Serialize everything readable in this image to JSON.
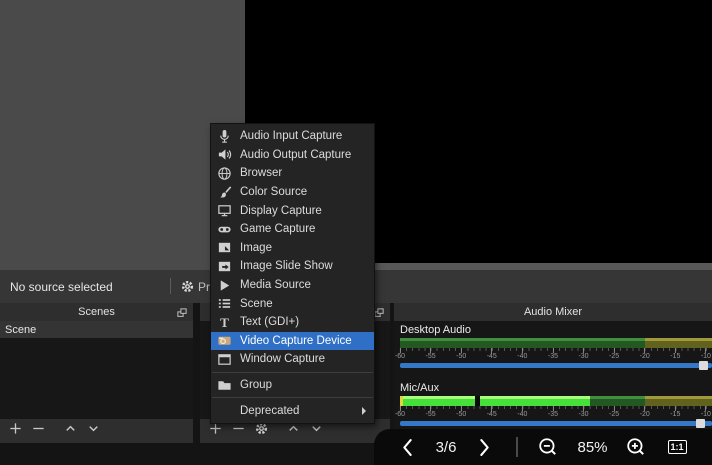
{
  "source_toolbar": {
    "status_text": "No source selected",
    "properties_label": "Prop"
  },
  "menu": {
    "items": [
      {
        "label": "Audio Input Capture",
        "icon": "microphone-icon"
      },
      {
        "label": "Audio Output Capture",
        "icon": "speaker-icon"
      },
      {
        "label": "Browser",
        "icon": "globe-icon"
      },
      {
        "label": "Color Source",
        "icon": "paintbrush-icon"
      },
      {
        "label": "Display Capture",
        "icon": "monitor-icon"
      },
      {
        "label": "Game Capture",
        "icon": "game-controller-icon"
      },
      {
        "label": "Image",
        "icon": "image-icon"
      },
      {
        "label": "Image Slide Show",
        "icon": "slideshow-icon"
      },
      {
        "label": "Media Source",
        "icon": "media-play-icon"
      },
      {
        "label": "Scene",
        "icon": "scene-list-icon"
      },
      {
        "label": "Text (GDI+)",
        "icon": "text-icon"
      },
      {
        "label": "Video Capture Device",
        "icon": "camera-icon",
        "highlighted": true
      },
      {
        "label": "Window Capture",
        "icon": "window-icon"
      },
      {
        "separator": true
      },
      {
        "label": "Group",
        "icon": "folder-icon"
      },
      {
        "separator": true
      },
      {
        "label": "Deprecated",
        "icon": null,
        "submenu": true
      }
    ]
  },
  "scenes_panel": {
    "title": "Scenes",
    "items": [
      "Scene"
    ],
    "toolbar": [
      {
        "name": "add-scene-button",
        "icon": "plus-icon"
      },
      {
        "name": "remove-scene-button",
        "icon": "minus-icon"
      },
      {
        "name": "gap"
      },
      {
        "name": "move-scene-up-button",
        "icon": "chevron-up-icon"
      },
      {
        "name": "move-scene-down-button",
        "icon": "chevron-down-icon"
      }
    ]
  },
  "sources_panel": {
    "toolbar": [
      {
        "name": "add-source-button",
        "icon": "plus-icon"
      },
      {
        "name": "remove-source-button",
        "icon": "minus-icon"
      },
      {
        "name": "source-properties-button",
        "icon": "gear-icon"
      },
      {
        "name": "gap"
      },
      {
        "name": "move-source-up-button",
        "icon": "chevron-up-icon"
      },
      {
        "name": "move-source-down-button",
        "icon": "chevron-down-icon"
      }
    ]
  },
  "audio_mixer": {
    "title": "Audio Mixer",
    "db_min": -60,
    "db_max": -9,
    "channels": [
      {
        "name": "Desktop Audio",
        "ticks": [
          -60,
          -55,
          -50,
          -45,
          -40,
          -35,
          -30,
          -25,
          -20,
          -15,
          -10
        ],
        "meter": {
          "left_marker": false,
          "segments": [
            {
              "from": -60,
              "to": -20,
              "style": "green-dim"
            },
            {
              "from": -20,
              "to": -9,
              "style": "yellow-dim"
            }
          ]
        },
        "slider_pct": 97
      },
      {
        "name": "Mic/Aux",
        "ticks": [
          -60,
          -55,
          -50,
          -45,
          -40,
          -35,
          -30,
          -25,
          -20,
          -15,
          -10
        ],
        "meter": {
          "left_marker": true,
          "segments": [
            {
              "from": -60,
              "to": -47.8,
              "style": "green-bright"
            },
            {
              "from": -47.8,
              "to": -47,
              "style": "gap"
            },
            {
              "from": -47,
              "to": -29,
              "style": "green-bright"
            },
            {
              "from": -29,
              "to": -20,
              "style": "green-dim"
            },
            {
              "from": -20,
              "to": -9,
              "style": "yellow-dim"
            }
          ]
        },
        "slider_pct": 96
      }
    ]
  },
  "viewer_toolbar": {
    "page_indicator": "3/6",
    "zoom_level": "85%",
    "actual_size_label": "1:1"
  },
  "colors": {
    "menu_highlight": "#2f6fc6",
    "slider_blue": "#3578c8",
    "meter_green_bright": "#46e03a",
    "meter_green_dim": "#235823",
    "meter_yellow_dim": "#62621f",
    "preview_empty_gray": "#4a4a4a",
    "panel_header_gray": "#2e2e2e"
  }
}
